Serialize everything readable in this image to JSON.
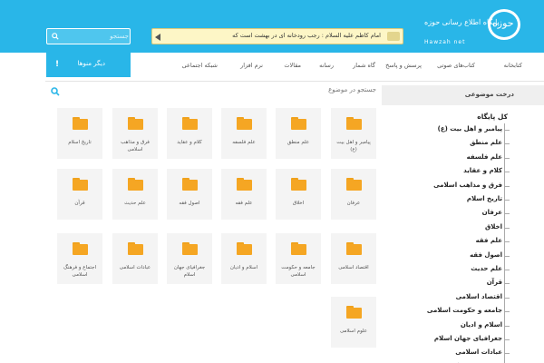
{
  "header": {
    "search_placeholder": "جستجو",
    "ticker_text": "امام کاظم علیه السلام : رجب رودخانه ای در بهشت است که",
    "logo_main": "حوزه",
    "logo_tagline": "پایگاه اطلاع رسانی حوزه",
    "logo_sub": "Hawzah net",
    "more_menu_label": "دیگر منوها",
    "more_menu_icon": "!",
    "accent_color": "#29b6e8"
  },
  "nav": {
    "items": [
      "کتابخانه",
      "کتاب‌های صوتی",
      "پرسش و پاسخ",
      "گاه شمار",
      "رسانه",
      "مقالات",
      "نرم افزار",
      "شبکه اجتماعی"
    ]
  },
  "main": {
    "search_label": "جستجو در موضوع",
    "tiles": [
      "پیامبر و اهل بیت (ع)",
      "علم منطق",
      "علم فلسفه",
      "کلام و عقاید",
      "فرق و مذاهب اسلامی",
      "تاریخ اسلام",
      "عرفان",
      "اخلاق",
      "علم فقه",
      "اصول فقه",
      "علم حدیث",
      "قرآن",
      "اقتصاد اسلامی",
      "جامعه و حکومت اسلامی",
      "اسلام و ادیان",
      "جغرافیای جهان اسلام",
      "عبادات اسلامی",
      "اجتماع و فرهنگ اسلامی",
      "علوم اسلامی"
    ]
  },
  "sidebar": {
    "title": "درخت موضوعی",
    "root": "کل پایگاه",
    "items": [
      "پیامبر و اهل بیت (ع)",
      "علم منطق",
      "علم فلسفه",
      "کلام و عقاید",
      "فرق و مذاهب اسلامی",
      "تاریخ اسلام",
      "عرفان",
      "اخلاق",
      "علم فقه",
      "اصول فقه",
      "علم حدیث",
      "قرآن",
      "اقتصاد اسلامی",
      "جامعه و حکومت اسلامی",
      "اسلام و ادیان",
      "جغرافیای جهان اسلام",
      "عبادات اسلامی",
      "اجتماع و فرهنگ اسلامی"
    ]
  }
}
